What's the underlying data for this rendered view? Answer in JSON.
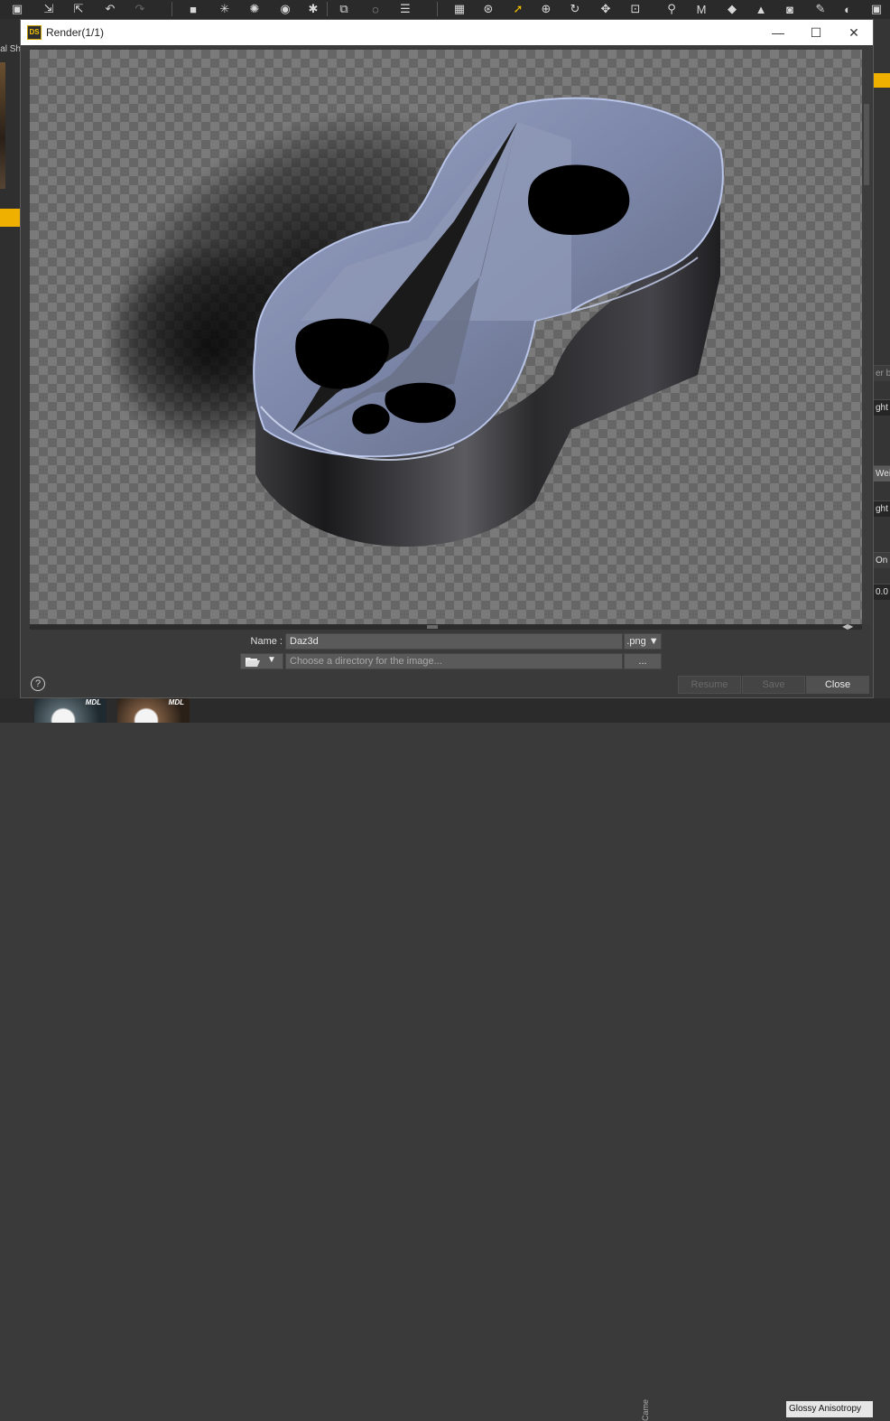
{
  "window": {
    "title": "Render(1/1)",
    "logo_text": "DS",
    "minimize": "—",
    "maximize": "☐",
    "close": "✕"
  },
  "background_app": {
    "left_tab_label": "Metal Sh",
    "right_panel_fields": [
      "er b",
      "ght",
      "Weig",
      "ght",
      "On",
      "0.0"
    ],
    "bottom_badge": "MDL",
    "bottom_tab": "Cameras",
    "glossy_label": "Glossy Anisotropy"
  },
  "render_image": {
    "subject": "figure-eight extruded metal object",
    "background": "transparent checkerboard"
  },
  "controls": {
    "name_label": "Name :",
    "name_value": "Daz3d",
    "format": ".png ▼",
    "directory_placeholder": "Choose a directory for the image...",
    "browse_label": "...",
    "folder_arrow": "▼"
  },
  "footer": {
    "help": "?",
    "resume": "Resume",
    "save": "Save",
    "close": "Close"
  },
  "colors": {
    "accent": "#f0b000",
    "window_bg": "#3a3a3a",
    "titlebar_bg": "#ffffff"
  }
}
